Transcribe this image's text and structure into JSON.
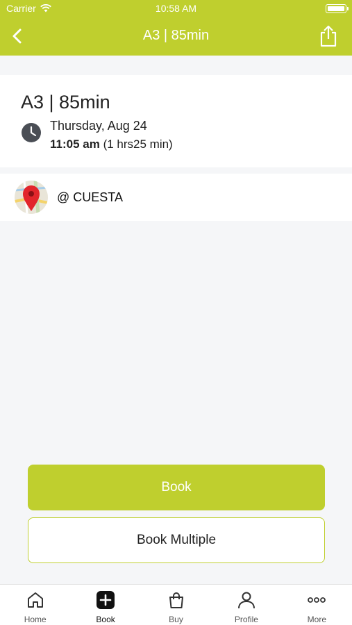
{
  "status_bar": {
    "carrier": "Carrier",
    "time": "10:58 AM"
  },
  "nav": {
    "title": "A3 | 85min",
    "back_icon": "chevron-left-icon",
    "share_icon": "share-icon"
  },
  "class": {
    "title": "A3 | 85min",
    "date": "Thursday, Aug 24",
    "start_time": "11:05 am",
    "duration": "(1 hrs25 min)"
  },
  "location": {
    "label": "@ CUESTA",
    "icon": "map-pin-icon"
  },
  "actions": {
    "book_label": "Book",
    "book_multiple_label": "Book Multiple"
  },
  "tabbar": {
    "items": [
      {
        "label": "Home",
        "icon": "home-icon"
      },
      {
        "label": "Book",
        "icon": "plus-icon"
      },
      {
        "label": "Buy",
        "icon": "shopping-bag-icon"
      },
      {
        "label": "Profile",
        "icon": "profile-icon"
      },
      {
        "label": "More",
        "icon": "more-icon"
      }
    ],
    "active": "Book"
  },
  "colors": {
    "accent": "#bfcf2e",
    "background": "#f5f6f8"
  }
}
